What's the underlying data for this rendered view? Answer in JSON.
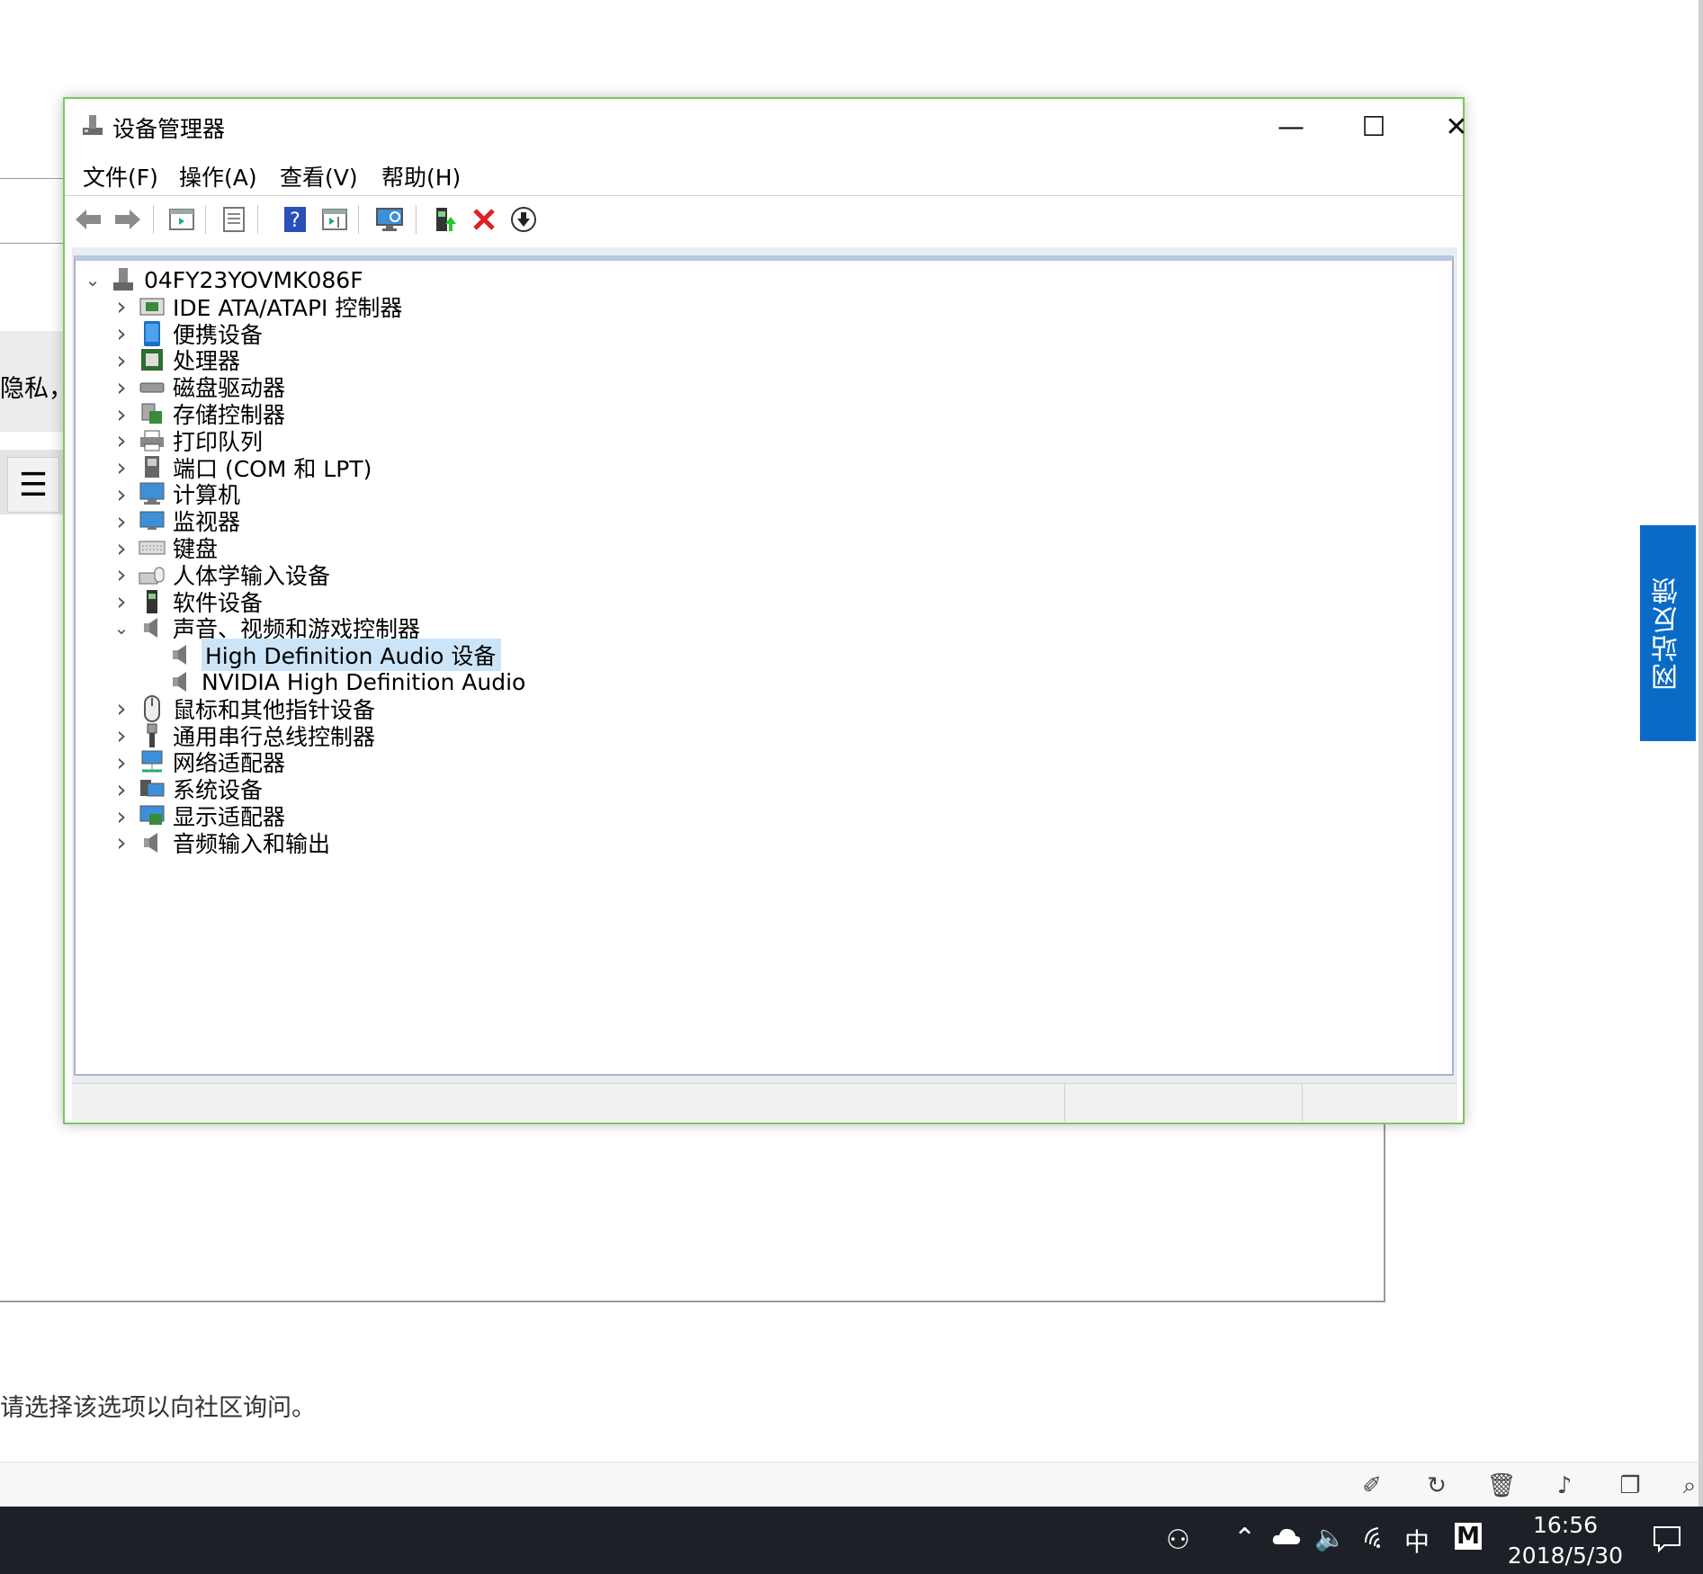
{
  "background": {
    "partial_text": "隐私，请",
    "bottom_text": "请选择该选项以向社区询问。",
    "feedback_tab": "网站反馈"
  },
  "window": {
    "title": "设备管理器",
    "controls": {
      "minimize": "—",
      "maximize": "☐",
      "close": "✕"
    },
    "menu": [
      "文件(F)",
      "操作(A)",
      "查看(V)",
      "帮助(H)"
    ],
    "toolbar": [
      "back-icon",
      "forward-icon",
      "show-hide-tree-icon",
      "properties-icon",
      "help-icon",
      "action-pane-icon",
      "scan-hardware-icon",
      "update-driver-icon",
      "uninstall-icon",
      "disable-device-icon"
    ],
    "tree": {
      "root": "04FY23YOVMK086F",
      "items": [
        {
          "label": "IDE ATA/ATAPI 控制器",
          "icon": "ide-controller-icon"
        },
        {
          "label": "便携设备",
          "icon": "portable-device-icon"
        },
        {
          "label": "处理器",
          "icon": "processor-icon"
        },
        {
          "label": "磁盘驱动器",
          "icon": "disk-drive-icon"
        },
        {
          "label": "存储控制器",
          "icon": "storage-controller-icon"
        },
        {
          "label": "打印队列",
          "icon": "printer-icon"
        },
        {
          "label": "端口 (COM 和 LPT)",
          "icon": "port-icon"
        },
        {
          "label": "计算机",
          "icon": "computer-icon"
        },
        {
          "label": "监视器",
          "icon": "monitor-icon"
        },
        {
          "label": "键盘",
          "icon": "keyboard-icon"
        },
        {
          "label": "人体学输入设备",
          "icon": "hid-icon"
        },
        {
          "label": "软件设备",
          "icon": "software-device-icon"
        },
        {
          "label": "声音、视频和游戏控制器",
          "icon": "speaker-icon",
          "expanded": true,
          "children": [
            {
              "label": "High Definition Audio 设备",
              "icon": "speaker-icon",
              "selected": true
            },
            {
              "label": "NVIDIA High Definition Audio",
              "icon": "speaker-icon"
            }
          ]
        },
        {
          "label": "鼠标和其他指针设备",
          "icon": "mouse-icon"
        },
        {
          "label": "通用串行总线控制器",
          "icon": "usb-icon"
        },
        {
          "label": "网络适配器",
          "icon": "network-adapter-icon"
        },
        {
          "label": "系统设备",
          "icon": "system-device-icon"
        },
        {
          "label": "显示适配器",
          "icon": "display-adapter-icon"
        },
        {
          "label": "音频输入和输出",
          "icon": "speaker-icon"
        }
      ]
    }
  },
  "taskbar": {
    "time": "16:56",
    "date": "2018/5/30",
    "ime": "中",
    "ime_mode": "M"
  }
}
